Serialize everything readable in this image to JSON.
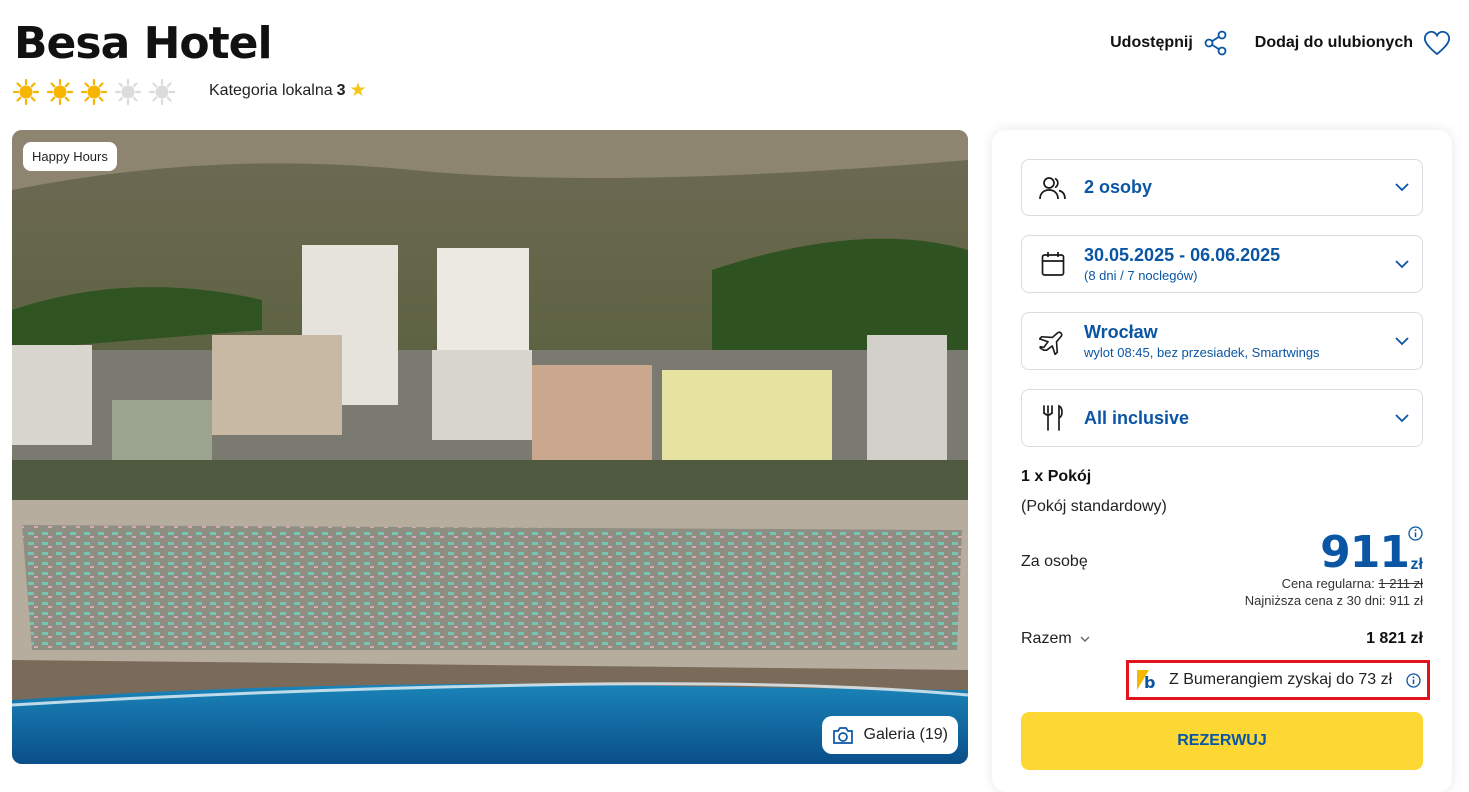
{
  "header": {
    "title": "Besa Hotel",
    "stars_filled": 3,
    "stars_total": 5,
    "category_label": "Kategoria lokalna",
    "category_value": "3",
    "share_label": "Udostępnij",
    "favorite_label": "Dodaj do ulubionych"
  },
  "hero": {
    "badge": "Happy Hours",
    "gallery_label": "Galeria (19)"
  },
  "booking": {
    "persons": "2 osoby",
    "dates": "30.05.2025 - 06.06.2025",
    "dates_sub": "(8 dni / 7 noclegów)",
    "departure": "Wrocław",
    "departure_sub": "wylot 08:45, bez przesiadek, Smartwings",
    "board": "All inclusive",
    "room": "1 x Pokój",
    "room_type": "(Pokój standardowy)",
    "per_person_label": "Za osobę",
    "price": "911",
    "currency": "zł",
    "regular_label": "Cena regularna:",
    "regular_price": "1 211 zł",
    "lowest_label": "Najniższa cena z 30 dni: 911 zł",
    "total_label": "Razem",
    "total_value": "1 821 zł",
    "bumerang_text": "Z Bumerangiem zyskaj do 73 zł",
    "reserve_label": "REZERWUJ"
  },
  "colors": {
    "brand_blue": "#0b56a4",
    "reserve_yellow": "#fdd835",
    "highlight_red": "#e1141b",
    "star_gold": "#f5c518"
  }
}
